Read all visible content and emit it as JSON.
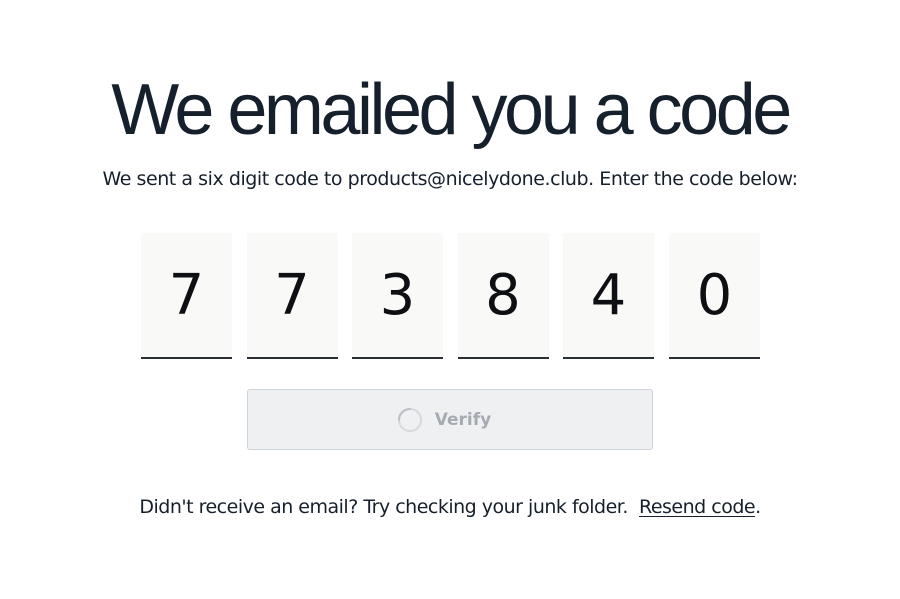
{
  "header": {
    "title": "We emailed you a code",
    "subtitle": "We sent a six digit code to products@nicelydone.club. Enter the code below:"
  },
  "code": {
    "digits": [
      "7",
      "7",
      "3",
      "8",
      "4",
      "0"
    ]
  },
  "verify": {
    "label": "Verify",
    "state": "loading"
  },
  "footer": {
    "prefix": "Didn't receive an email? Try checking your junk folder.",
    "resend_label": "Resend code",
    "suffix": "."
  },
  "icons": {
    "spinner": "spinner-icon"
  },
  "colors": {
    "text": "#16202c",
    "digit_background": "#f9f9f8",
    "button_background": "#eef0f2",
    "button_text_disabled": "#a6abb1"
  }
}
